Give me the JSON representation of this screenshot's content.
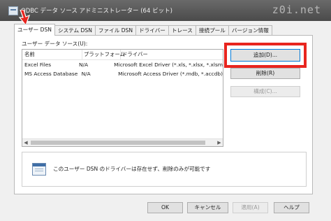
{
  "window": {
    "title": "ODBC データ ソース アドミニストレーター (64 ビット)",
    "watermark": "z0i.net"
  },
  "tabs": [
    {
      "label": "ユーザー DSN",
      "active": true
    },
    {
      "label": "システム DSN"
    },
    {
      "label": "ファイル DSN"
    },
    {
      "label": "ドライバー"
    },
    {
      "label": "トレース"
    },
    {
      "label": "接続プール"
    },
    {
      "label": "バージョン情報"
    }
  ],
  "panel": {
    "group_label": "ユーザー データ ソース(U):",
    "columns": [
      "名前",
      "プラットフォーム",
      "ドライバー"
    ],
    "rows": [
      {
        "name": "Excel Files",
        "platform": "N/A",
        "driver": "Microsoft Excel Driver (*.xls, *.xlsx, *.xlsm"
      },
      {
        "name": "MS Access Database",
        "platform": "N/A",
        "driver": "Microsoft Access Driver (*.mdb, *.accdb)"
      }
    ],
    "buttons": {
      "add": "追加(D)...",
      "remove": "削除(R)",
      "configure": "構成(C)..."
    },
    "info_text": "このユーザー DSN のドライバーは存在せず、削除のみが可能です"
  },
  "footer": {
    "ok": "OK",
    "cancel": "キャンセル",
    "apply": "適用(A)",
    "help": "ヘルプ"
  },
  "colors": {
    "highlight": "#e8251f",
    "focus": "#0078d7"
  }
}
